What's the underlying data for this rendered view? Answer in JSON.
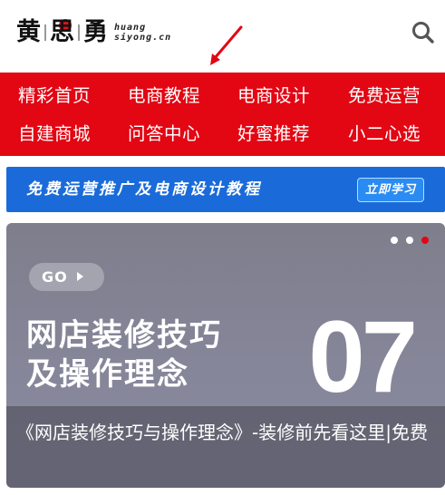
{
  "header": {
    "logo": {
      "char1": "黄",
      "char2": "思",
      "char3": "勇",
      "sub1": "huang",
      "sub2": "siyong.cn"
    },
    "search_icon": "search-icon"
  },
  "nav": {
    "items": [
      "精彩首页",
      "电商教程",
      "电商设计",
      "免费运营",
      "自建商城",
      "问答中心",
      "好蜜推荐",
      "小二心选"
    ]
  },
  "promo": {
    "text": "免费运营推广及电商设计教程",
    "button": "立即学习"
  },
  "slide": {
    "go_label": "GO",
    "title_line1": "网店装修技巧",
    "title_line2": "及操作理念",
    "number": "07",
    "caption": "《网店装修技巧与操作理念》-装修前先看这里|免费",
    "dots_total": 3,
    "dots_active": 3
  },
  "colors": {
    "nav_red": "#e30613",
    "promo_blue": "#1a6bd9",
    "annotation_arrow": "#e30613"
  }
}
